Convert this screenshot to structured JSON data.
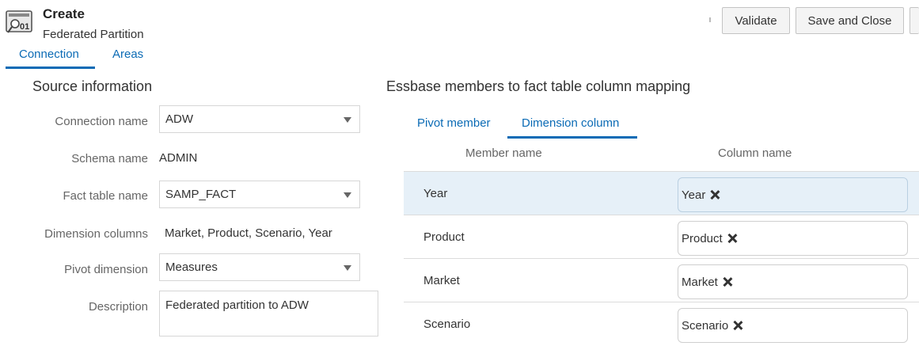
{
  "header": {
    "title": "Create",
    "subtitle": "Federated Partition",
    "validate_label": "Validate",
    "save_close_label": "Save and Close"
  },
  "tabs": [
    {
      "label": "Connection",
      "active": true
    },
    {
      "label": "Areas",
      "active": false
    }
  ],
  "source": {
    "title": "Source information",
    "fields": {
      "connection_label": "Connection name",
      "connection_value": "ADW",
      "schema_label": "Schema name",
      "schema_value": "ADMIN",
      "fact_label": "Fact table name",
      "fact_value": "SAMP_FACT",
      "dimcols_label": "Dimension columns",
      "dimcols_value": "Market, Product, Scenario, Year",
      "pivot_label": "Pivot dimension",
      "pivot_value": "Measures",
      "description_label": "Description",
      "description_value": "Federated partition to ADW"
    }
  },
  "mapping": {
    "title": "Essbase members to fact table column mapping",
    "tabs": [
      {
        "label": "Pivot member",
        "active": false
      },
      {
        "label": "Dimension column",
        "active": true
      }
    ],
    "headers": {
      "member": "Member name",
      "column": "Column name"
    },
    "rows": [
      {
        "member": "Year",
        "column": "Year",
        "selected": true
      },
      {
        "member": "Product",
        "column": "Product",
        "selected": false
      },
      {
        "member": "Market",
        "column": "Market",
        "selected": false
      },
      {
        "member": "Scenario",
        "column": "Scenario",
        "selected": false
      }
    ]
  },
  "colors": {
    "accent": "#0b6bb5",
    "selected_row": "#e6f0f8"
  }
}
